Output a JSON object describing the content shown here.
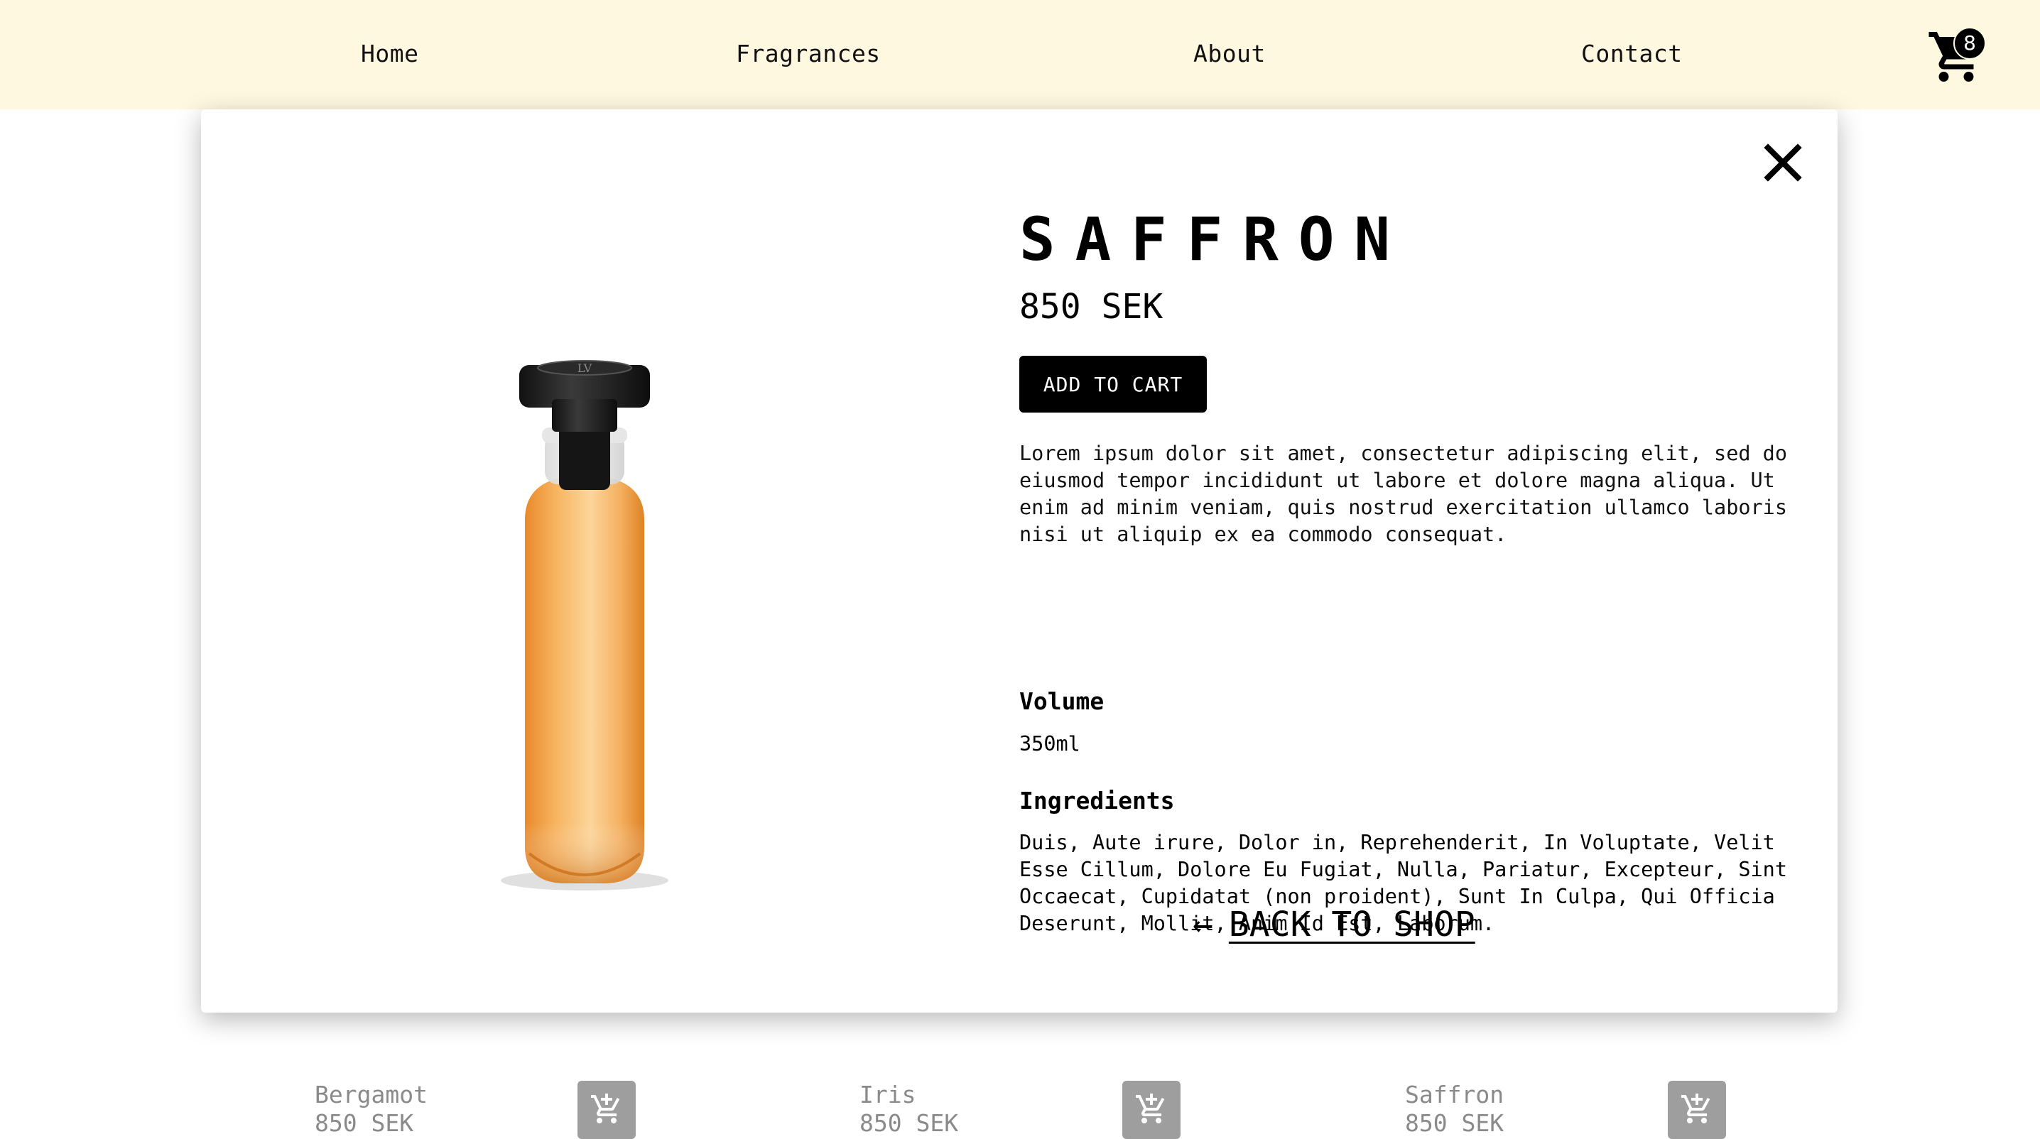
{
  "nav": {
    "items": [
      {
        "label": "Home"
      },
      {
        "label": "Fragrances"
      },
      {
        "label": "About"
      },
      {
        "label": "Contact"
      }
    ],
    "cart_count": "8",
    "cart_icon": "cart-icon"
  },
  "background_products": [
    {
      "name": "Bergamot",
      "price": "850 SEK",
      "icon": "add-to-cart-icon"
    },
    {
      "name": "Iris",
      "price": "850 SEK",
      "icon": "add-to-cart-icon"
    },
    {
      "name": "Saffron",
      "price": "850 SEK",
      "icon": "add-to-cart-icon"
    }
  ],
  "modal": {
    "close_icon": "close-icon",
    "product": {
      "title": "SAFFRON",
      "price": "850 SEK",
      "add_to_cart_label": "ADD TO CART",
      "description": "Lorem ipsum dolor sit amet, consectetur adipiscing elit, sed do\neiusmod tempor incididunt ut labore et dolore magna aliqua. Ut\nenim ad minim veniam, quis nostrud exercitation ullamco laboris\nnisi ut aliquip ex ea commodo consequat.",
      "volume_heading": "Volume",
      "volume": "350ml",
      "ingredients_heading": "Ingredients",
      "ingredients": "Duis, Aute irure, Dolor in, Reprehenderit, In Voluptate, Velit\nEsse Cillum, Dolore Eu Fugiat, Nulla, Pariatur, Excepteur, Sint\nOccaecat, Cupidatat (non proident), Sunt In Culpa, Qui Officia\nDeserunt, Mollit, Anim Id Est, Laborum."
    },
    "back_arrow": "←",
    "back_label": "BACK TO SHOP"
  },
  "colors": {
    "navbar_bg": "#fff8e1",
    "button_bg": "#000000",
    "bottle_liquid": "#f5a742",
    "muted_text": "#8a8a8a"
  }
}
